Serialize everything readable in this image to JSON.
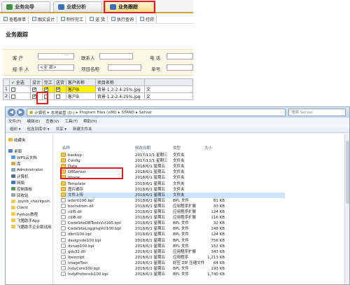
{
  "tabs": [
    {
      "label": "业务向导",
      "color": "#3f8f3f"
    },
    {
      "label": "业绩分析",
      "color": "#3b6fb5"
    },
    {
      "label": "业务跟踪",
      "color": "#3b6fb5"
    }
  ],
  "toolbar": [
    "查看原单",
    "图文设计",
    "制作完工",
    "送 货",
    "执行查询",
    "打印"
  ],
  "page_title": "业务跟踪",
  "form": {
    "customer_label": "客 户",
    "contact_label": "联系人",
    "phone_label": "电 话",
    "handler_label": "经 手 人",
    "handler_value": "<全 部>",
    "project_label": "项目名称",
    "order_label": "单号"
  },
  "grid": {
    "headers": [
      "全选",
      "设计",
      "完工",
      "送货",
      "客户名称",
      "项目名称",
      ""
    ],
    "rows": [
      {
        "num": "1",
        "design": true,
        "done": true,
        "deliver": true,
        "customer": "客户B",
        "project": "背景·1.2-2.4-25%.jpg",
        "extra": "文"
      },
      {
        "num": "2",
        "design": true,
        "done": false,
        "deliver": false,
        "customer": "客户B",
        "project": "背景·1.2-2.4-25%.jpg",
        "extra": "文"
      }
    ]
  },
  "explorer": {
    "breadcrumb": [
      "计算机",
      "本地磁盘 (D:)",
      "Program Files (x86)",
      "STAND",
      "Server"
    ],
    "search_placeholder": "搜索 Server",
    "menu": [
      "文件(F)",
      "编辑(E)",
      "查看(V)",
      "工具(T)",
      "帮助(H)"
    ],
    "commands": [
      "组织 ▾",
      "包含到库中 ▾",
      "共享 ▾",
      "新建文件夹"
    ],
    "nav": [
      "收藏夹",
      "桌面",
      "WPS云文档",
      "库",
      "Administrator",
      "计算机",
      "网络",
      "控制面板",
      "回收站",
      ".ipynb_checkpoin",
      "Client",
      "Python教程",
      "飞猪助手App",
      "飞猪助手企业版试用"
    ],
    "columns": [
      "名称",
      "修改日期",
      "类型",
      "大小"
    ],
    "files": [
      {
        "name": "backup",
        "date": "2017/11/1 星期三",
        "type": "文件夹",
        "size": "",
        "kind": "folder"
      },
      {
        "name": "Config",
        "date": "2017/11/1 星期三",
        "type": "文件夹",
        "size": "",
        "kind": "folder"
      },
      {
        "name": "Data",
        "date": "2018/6/1 星期五",
        "type": "文件夹",
        "size": "",
        "kind": "folder"
      },
      {
        "name": "DBServer",
        "date": "2018/6/1 星期五",
        "type": "文件夹",
        "size": "",
        "kind": "folder"
      },
      {
        "name": "Image",
        "date": "2018/6/1 星期五",
        "type": "文件夹",
        "size": "",
        "kind": "folder"
      },
      {
        "name": "Template",
        "date": "2018/6/1 星期五",
        "type": "文件夹",
        "size": "",
        "kind": "folder"
      },
      {
        "name": "图片缓存",
        "date": "2018/6/1 星期五",
        "type": "文件夹",
        "size": "",
        "kind": "folder"
      },
      {
        "name": "文件上传",
        "date": "2018/6/1 星期五",
        "type": "文件夹",
        "size": "",
        "kind": "folder"
      },
      {
        "name": "adortl100.bpl",
        "date": "2018/6/1 星期五",
        "type": "BPL 文件",
        "size": "81 KB",
        "kind": "file"
      },
      {
        "name": "borlndmm.dll",
        "date": "2018/6/1 星期五",
        "type": "应用程序扩展",
        "size": "33 KB",
        "kind": "file"
      },
      {
        "name": "cdl5.dll",
        "date": "2018/6/1 星期五",
        "type": "应用程序扩展",
        "size": "124 KB",
        "kind": "file"
      },
      {
        "name": "cdl8.dll",
        "date": "2018/6/1 星期五",
        "type": "应用程序扩展",
        "size": "116 KB",
        "kind": "file"
      },
      {
        "name": "CodeSiteDBToolsVcl105.bpl",
        "date": "2018/6/1 星期五",
        "type": "BPL 文件",
        "size": "32 KB",
        "kind": "file"
      },
      {
        "name": "CodeSiteLoggingVcl100.bpl",
        "date": "2018/6/1 星期五",
        "type": "BPL 文件",
        "size": "248 KB",
        "kind": "file"
      },
      {
        "name": "dbrtl100.bpl",
        "date": "2018/6/1 星期五",
        "type": "BPL 文件",
        "size": "124 KB",
        "kind": "file"
      },
      {
        "name": "designide100.bpl",
        "date": "2018/6/1 星期五",
        "type": "BPL 文件",
        "size": "756 KB",
        "kind": "file"
      },
      {
        "name": "dsnap100.bpl",
        "date": "2018/6/1 星期五",
        "type": "BPL 文件",
        "size": "152 KB",
        "kind": "file"
      },
      {
        "name": "gds32.dll",
        "date": "2018/6/1 星期五",
        "type": "应用程序扩展",
        "size": "343 KB",
        "kind": "file"
      },
      {
        "name": "Ibescript",
        "date": "2018/6/1 星期五",
        "type": "应用程序",
        "size": "1,213 KB",
        "kind": "file"
      },
      {
        "name": "ImageTool",
        "date": "2018/6/1 星期五",
        "type": "好压 ZIP 压缩文件",
        "size": "64 KB",
        "kind": "file"
      },
      {
        "name": "IndyCore100.bpl",
        "date": "2018/6/1 星期五",
        "type": "BPL 文件",
        "size": "193 KB",
        "kind": "file"
      },
      {
        "name": "IndyProtocols100.bpl",
        "date": "2018/6/1 星期五",
        "type": "BPL 文件",
        "size": "1,740 KB",
        "kind": "file"
      }
    ]
  }
}
